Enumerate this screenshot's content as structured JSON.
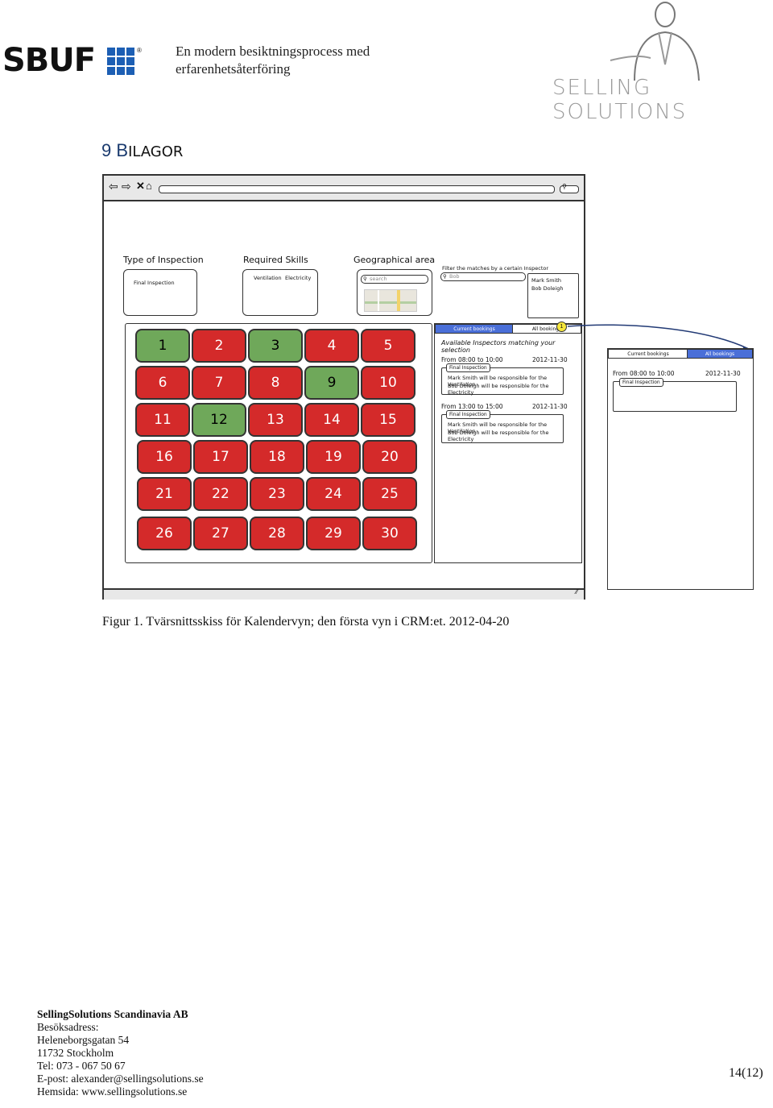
{
  "header": {
    "sbuf_logo": "SBUF",
    "title_line1": "En modern besiktningsprocess med",
    "title_line2": "erfarenhetsåterföring",
    "selling_logo": "SELLING SOLUTIONS"
  },
  "section": {
    "number": "9",
    "title_first": "B",
    "title_rest": "ILAGOR"
  },
  "mockup": {
    "filters": {
      "type_label": "Type of Inspection",
      "type_value": "Final Inspection",
      "skills_label": "Required Skills",
      "skill_1": "Ventilation",
      "skill_2": "Electricity",
      "geo_label": "Geographical area",
      "search_placeholder": "search",
      "inspector_filter_label": "Filter the matches by a certain Inspector",
      "inspector_search": "Bob",
      "inspector_1": "Mark Smith",
      "inspector_2": "Bob Doleigh"
    },
    "calendar": {
      "days": [
        {
          "n": "1",
          "s": "green"
        },
        {
          "n": "2",
          "s": "red"
        },
        {
          "n": "3",
          "s": "green"
        },
        {
          "n": "4",
          "s": "red"
        },
        {
          "n": "5",
          "s": "red"
        },
        {
          "n": "6",
          "s": "red"
        },
        {
          "n": "7",
          "s": "red"
        },
        {
          "n": "8",
          "s": "red"
        },
        {
          "n": "9",
          "s": "green"
        },
        {
          "n": "10",
          "s": "red"
        },
        {
          "n": "11",
          "s": "red"
        },
        {
          "n": "12",
          "s": "green"
        },
        {
          "n": "13",
          "s": "red"
        },
        {
          "n": "14",
          "s": "red"
        },
        {
          "n": "15",
          "s": "red"
        },
        {
          "n": "16",
          "s": "red"
        },
        {
          "n": "17",
          "s": "red"
        },
        {
          "n": "18",
          "s": "red"
        },
        {
          "n": "19",
          "s": "red"
        },
        {
          "n": "20",
          "s": "red"
        },
        {
          "n": "21",
          "s": "red"
        },
        {
          "n": "22",
          "s": "red"
        },
        {
          "n": "23",
          "s": "red"
        },
        {
          "n": "24",
          "s": "red"
        },
        {
          "n": "25",
          "s": "red"
        },
        {
          "n": "26",
          "s": "red"
        },
        {
          "n": "27",
          "s": "red"
        },
        {
          "n": "28",
          "s": "red"
        },
        {
          "n": "29",
          "s": "red"
        },
        {
          "n": "30",
          "s": "red"
        }
      ]
    },
    "bookings": {
      "tab_current": "Current bookings",
      "tab_all": "All bookings",
      "badge": "1",
      "available_title": "Available Inspectors matching your selection",
      "slot1_time": "From 08:00 to 10:00",
      "slot1_date": "2012-11-30",
      "slot1_type": "Final Inspection",
      "slot1_line1": "Mark Smith will be responsible for the Ventilation",
      "slot1_line2": "Bob Doleigh will be responsible for the Electricity",
      "slot2_time": "From 13:00 to 15:00",
      "slot2_date": "2012-11-30",
      "slot2_type": "Final Inspection",
      "slot2_line1": "Mark Smith will be responsible for the Ventilation",
      "slot2_line2": "Bob Doleigh will be responsible for the Electricity"
    },
    "side_panel": {
      "tab_current": "Current bookings",
      "tab_all": "All bookings",
      "time": "From 08:00 to 10:00",
      "date": "2012-11-30",
      "type": "Final Inspection"
    }
  },
  "caption": "Figur 1. Tvärsnittsskiss för Kalendervyn; den första vyn i CRM:et. 2012-04-20",
  "footer": {
    "company": "SellingSolutions Scandinavia AB",
    "visit_label": "Besöksadress:",
    "street": "Heleneborgsgatan 54",
    "city": "11732 Stockholm",
    "phone": "Tel: 073 - 067 50 67",
    "email": "E-post: alexander@sellingsolutions.se",
    "web": "Hemsida: www.sellingsolutions.se",
    "page": "14(12)"
  },
  "colors": {
    "red_day": "#d42a2a",
    "green_day": "#6fa85a",
    "tab_active": "#4a6fd8",
    "heading": "#1a3a6e"
  }
}
